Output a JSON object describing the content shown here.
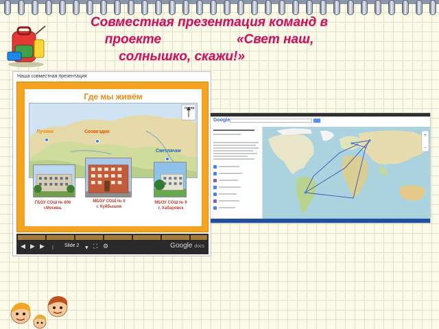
{
  "title": {
    "line1": "Совместная презентация команд в",
    "line2a": "проекте",
    "line2b": "«Свет наш,",
    "line3": "солнышко, скажи!»"
  },
  "viewer": {
    "caption": "Наша совместная презентация",
    "slide_title": "Где мы живём",
    "map_labels": {
      "teamA": "Лучики",
      "teamB": "Созвездие",
      "teamC": "Светлячки",
      "north": "север"
    },
    "schools": {
      "s1": {
        "line1": "ГБОУ СОШ № 806",
        "line2": "г.Москва."
      },
      "s2": {
        "line1": "МБОУ СОШ № 6",
        "line2": "г. Куйбышев"
      },
      "s3": {
        "line1": "МБОУ СОШ № 9",
        "line2": "г. Хабаровск"
      }
    },
    "toolbar": {
      "slide_label": "Slide 2",
      "brand": "Google",
      "brand_suffix": "docs"
    }
  },
  "gmap": {
    "logo": "Google"
  },
  "colors": {
    "title": "#c2185b",
    "slide_frame": "#f4a31e",
    "slide_title": "#f08a0c",
    "school_label": "#c0392b"
  }
}
